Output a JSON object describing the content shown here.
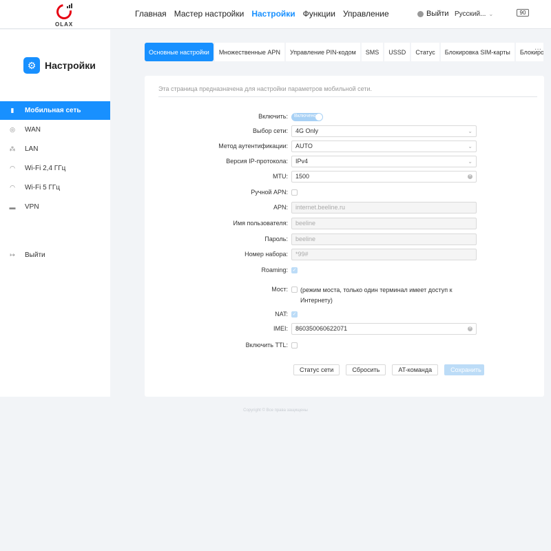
{
  "header": {
    "logo_text": "OLAX",
    "nav": [
      "Главная",
      "Мастер настройки",
      "Настройки",
      "Функции",
      "Управление"
    ],
    "active_nav": "Настройки",
    "logout": "Выйти",
    "language": "Русский...",
    "battery": "90"
  },
  "sidebar": {
    "title": "Настройки",
    "items": [
      {
        "label": "Мобильная сеть",
        "icon": "signal-icon",
        "active": true
      },
      {
        "label": "WAN",
        "icon": "globe-icon"
      },
      {
        "label": "LAN",
        "icon": "network-icon"
      },
      {
        "label": "Wi-Fi 2,4 ГГц",
        "icon": "wifi-icon"
      },
      {
        "label": "Wi-Fi 5 ГГц",
        "icon": "wifi-icon"
      },
      {
        "label": "VPN",
        "icon": "vpn-icon"
      }
    ],
    "logout": "Выйти"
  },
  "tabs": [
    "Основные настройки",
    "Множественные APN",
    "Управление PIN-кодом",
    "SMS",
    "USSD",
    "Статус",
    "Блокировка SIM-карты",
    "Блокиров"
  ],
  "tab_more": "···",
  "main": {
    "description": "Эта страница предназначена для настройки параметров мобильной сети.",
    "enable": {
      "label": "Включить:",
      "toggle_text": "Включено"
    },
    "network": {
      "label": "Выбор сети:",
      "value": "4G Only"
    },
    "auth": {
      "label": "Метод аутентификации:",
      "value": "AUTO"
    },
    "ip": {
      "label": "Версия IP-протокола:",
      "value": "IPv4"
    },
    "mtu": {
      "label": "MTU:",
      "value": "1500"
    },
    "manual_apn": {
      "label": "Ручной APN:"
    },
    "apn": {
      "label": "APN:",
      "value": "internet.beeline.ru"
    },
    "username": {
      "label": "Имя пользователя:",
      "value": "beeline"
    },
    "password": {
      "label": "Пароль:",
      "value": "beeline"
    },
    "dial": {
      "label": "Номер набора:",
      "value": "*99#"
    },
    "roaming": {
      "label": "Roaming:"
    },
    "bridge": {
      "label": "Мост:",
      "note": "(режим моста, только один терминал имеет доступ к Интернету)"
    },
    "nat": {
      "label": "NAT:"
    },
    "imei": {
      "label": "IMEI:",
      "value": "860350060622071"
    },
    "ttl": {
      "label": "Включить TTL:"
    },
    "buttons": {
      "status": "Статус сети",
      "reset": "Сбросить",
      "at": "AT-команда",
      "save": "Сохранить"
    }
  },
  "footer": {
    "copyright": "Copyright © Все права защищены"
  },
  "colors": {
    "accent": "#1890ff",
    "disabled_accent": "#bcdcf7",
    "brand_red": "#e60012"
  }
}
